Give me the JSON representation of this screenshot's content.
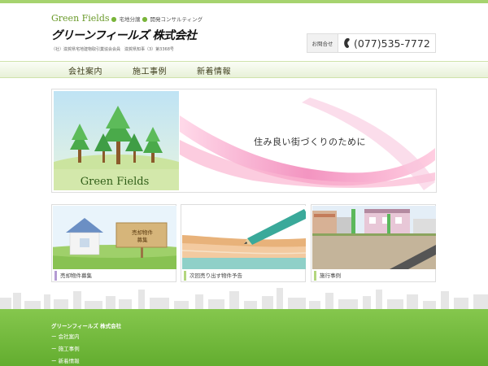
{
  "header": {
    "logo_en": "Green Fields",
    "tagline_1": "宅地分譲",
    "tagline_2": "開発コンサルティング",
    "logo_jp": "グリーンフィールズ 株式会社",
    "license": "（社）滋賀県宅地建物取引業協会会員　滋賀県知事（3）第3368号",
    "contact_label": "お問合せ",
    "phone": "(077)535-7772"
  },
  "nav": {
    "items": [
      "会社案内",
      "施工事例",
      "新着情報"
    ]
  },
  "banner": {
    "brand": "Green Fields",
    "message": "住み良い街づくりのために"
  },
  "cards": [
    {
      "sign_line1": "売却物件",
      "sign_line2": "募集",
      "caption": "売却物件募集"
    },
    {
      "caption": "次回売り出す物件予告"
    },
    {
      "caption": "施行事例"
    }
  ],
  "footer": {
    "company": "グリーンフィールズ 株式会社",
    "links": [
      "ー 会社案内",
      "ー 施工事例",
      "ー 新着情報"
    ]
  },
  "colors": {
    "brand_green": "#79b53a",
    "footer_green": "#6cb436",
    "ribbon_pink": "#f07ab1"
  }
}
